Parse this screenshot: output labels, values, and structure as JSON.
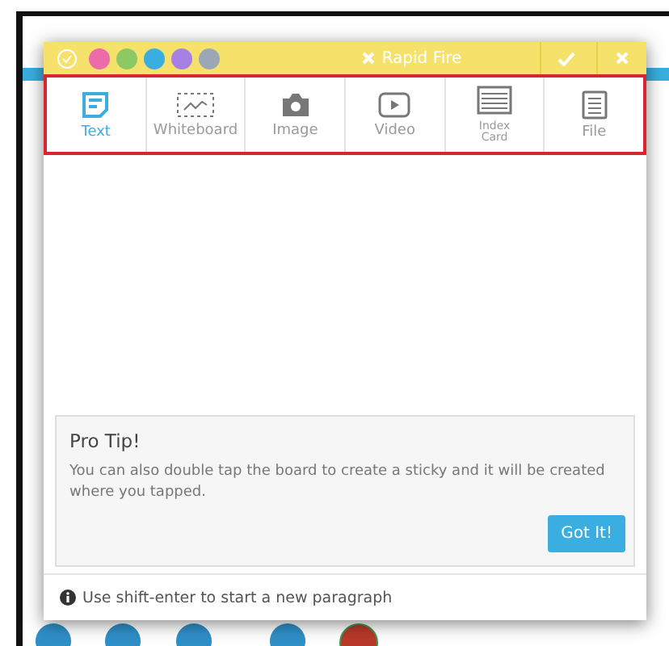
{
  "header": {
    "dots": [
      {
        "color": "#ec6ba9"
      },
      {
        "color": "#8cc863"
      },
      {
        "color": "#3aaee0"
      },
      {
        "color": "#a680e2"
      },
      {
        "color": "#9ba7b6"
      }
    ],
    "title": "Rapid Fire"
  },
  "tabs": [
    {
      "label": "Text",
      "selected": true
    },
    {
      "label": "Whiteboard",
      "selected": false
    },
    {
      "label": "Image",
      "selected": false
    },
    {
      "label": "Video",
      "selected": false
    },
    {
      "label": "Index\nCard",
      "selected": false
    },
    {
      "label": "File",
      "selected": false
    }
  ],
  "tip": {
    "title": "Pro Tip!",
    "text": "You can also double tap the board to create a sticky and it will be created where you tapped.",
    "button": "Got It!"
  },
  "footer": {
    "hint": "Use shift-enter to start a new paragraph"
  }
}
